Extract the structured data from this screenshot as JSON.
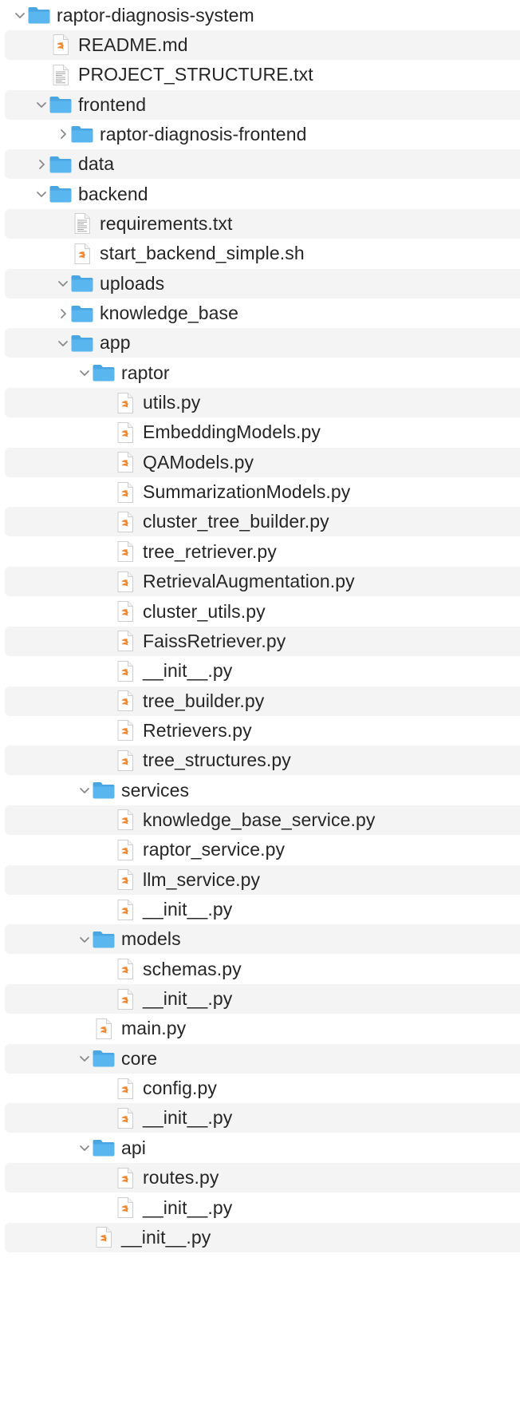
{
  "colors": {
    "stripe": "#f4f4f4",
    "folder": "#5ab6ee",
    "folder_tab": "#49a6e2",
    "swift_accent": "#f1862d",
    "text": "#262626",
    "chevron": "#8a8a8a"
  },
  "tree": {
    "rows": [
      {
        "label": "raptor-diagnosis-system",
        "kind": "folder",
        "depth": 0,
        "state": "expanded"
      },
      {
        "label": "README.md",
        "kind": "swift",
        "depth": 1,
        "state": "none"
      },
      {
        "label": "PROJECT_STRUCTURE.txt",
        "kind": "text",
        "depth": 1,
        "state": "none"
      },
      {
        "label": "frontend",
        "kind": "folder",
        "depth": 1,
        "state": "expanded"
      },
      {
        "label": "raptor-diagnosis-frontend",
        "kind": "folder",
        "depth": 2,
        "state": "collapsed"
      },
      {
        "label": "data",
        "kind": "folder",
        "depth": 1,
        "state": "collapsed"
      },
      {
        "label": "backend",
        "kind": "folder",
        "depth": 1,
        "state": "expanded"
      },
      {
        "label": "requirements.txt",
        "kind": "text",
        "depth": 2,
        "state": "none"
      },
      {
        "label": "start_backend_simple.sh",
        "kind": "swift",
        "depth": 2,
        "state": "none"
      },
      {
        "label": "uploads",
        "kind": "folder",
        "depth": 2,
        "state": "expanded"
      },
      {
        "label": "knowledge_base",
        "kind": "folder",
        "depth": 2,
        "state": "collapsed"
      },
      {
        "label": "app",
        "kind": "folder",
        "depth": 2,
        "state": "expanded"
      },
      {
        "label": "raptor",
        "kind": "folder",
        "depth": 3,
        "state": "expanded"
      },
      {
        "label": "utils.py",
        "kind": "swift",
        "depth": 4,
        "state": "none"
      },
      {
        "label": "EmbeddingModels.py",
        "kind": "swift",
        "depth": 4,
        "state": "none"
      },
      {
        "label": "QAModels.py",
        "kind": "swift",
        "depth": 4,
        "state": "none"
      },
      {
        "label": "SummarizationModels.py",
        "kind": "swift",
        "depth": 4,
        "state": "none"
      },
      {
        "label": "cluster_tree_builder.py",
        "kind": "swift",
        "depth": 4,
        "state": "none"
      },
      {
        "label": "tree_retriever.py",
        "kind": "swift",
        "depth": 4,
        "state": "none"
      },
      {
        "label": "RetrievalAugmentation.py",
        "kind": "swift",
        "depth": 4,
        "state": "none"
      },
      {
        "label": "cluster_utils.py",
        "kind": "swift",
        "depth": 4,
        "state": "none"
      },
      {
        "label": "FaissRetriever.py",
        "kind": "swift",
        "depth": 4,
        "state": "none"
      },
      {
        "label": "__init__.py",
        "kind": "swift",
        "depth": 4,
        "state": "none"
      },
      {
        "label": "tree_builder.py",
        "kind": "swift",
        "depth": 4,
        "state": "none"
      },
      {
        "label": "Retrievers.py",
        "kind": "swift",
        "depth": 4,
        "state": "none"
      },
      {
        "label": "tree_structures.py",
        "kind": "swift",
        "depth": 4,
        "state": "none"
      },
      {
        "label": "services",
        "kind": "folder",
        "depth": 3,
        "state": "expanded"
      },
      {
        "label": "knowledge_base_service.py",
        "kind": "swift",
        "depth": 4,
        "state": "none"
      },
      {
        "label": "raptor_service.py",
        "kind": "swift",
        "depth": 4,
        "state": "none"
      },
      {
        "label": "llm_service.py",
        "kind": "swift",
        "depth": 4,
        "state": "none"
      },
      {
        "label": "__init__.py",
        "kind": "swift",
        "depth": 4,
        "state": "none"
      },
      {
        "label": "models",
        "kind": "folder",
        "depth": 3,
        "state": "expanded"
      },
      {
        "label": "schemas.py",
        "kind": "swift",
        "depth": 4,
        "state": "none"
      },
      {
        "label": "__init__.py",
        "kind": "swift",
        "depth": 4,
        "state": "none"
      },
      {
        "label": "main.py",
        "kind": "swift",
        "depth": 3,
        "state": "none"
      },
      {
        "label": "core",
        "kind": "folder",
        "depth": 3,
        "state": "expanded"
      },
      {
        "label": "config.py",
        "kind": "swift",
        "depth": 4,
        "state": "none"
      },
      {
        "label": "__init__.py",
        "kind": "swift",
        "depth": 4,
        "state": "none"
      },
      {
        "label": "api",
        "kind": "folder",
        "depth": 3,
        "state": "expanded"
      },
      {
        "label": "routes.py",
        "kind": "swift",
        "depth": 4,
        "state": "none"
      },
      {
        "label": "__init__.py",
        "kind": "swift",
        "depth": 4,
        "state": "none"
      },
      {
        "label": "__init__.py",
        "kind": "swift",
        "depth": 3,
        "state": "none"
      }
    ]
  }
}
